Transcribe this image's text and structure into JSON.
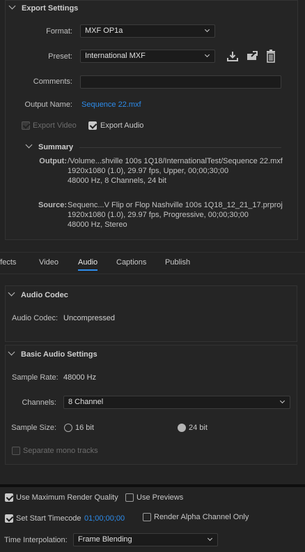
{
  "export_settings": {
    "title": "Export Settings",
    "format_label": "Format:",
    "format_value": "MXF OP1a",
    "preset_label": "Preset:",
    "preset_value": "International MXF",
    "comments_label": "Comments:",
    "comments_value": "",
    "output_name_label": "Output Name:",
    "output_name_value": "Sequence 22.mxf",
    "export_video_label": "Export Video",
    "export_video_checked": true,
    "export_audio_label": "Export Audio",
    "export_audio_checked": true
  },
  "summary": {
    "title": "Summary",
    "output_key": "Output:",
    "output_lines": [
      "/Volume...shville 100s 1Q18/InternationalTest/Sequence 22.mxf",
      "1920x1080 (1.0), 29.97 fps, Upper, 00;00;30;00",
      "48000 Hz, 8 Channels, 24 bit"
    ],
    "source_key": "Source:",
    "source_lines": [
      "Sequenc...V Flip or Flop Nashville 100s 1Q18_12_21_17.prproj",
      "1920x1080 (1.0), 29.97 fps, Progressive, 00;00;30;00",
      "48000 Hz, Stereo"
    ]
  },
  "tabs": [
    "Effects",
    "Video",
    "Audio",
    "Captions",
    "Publish"
  ],
  "active_tab": "Audio",
  "audio_codec": {
    "title": "Audio Codec",
    "codec_label": "Audio Codec:",
    "codec_value": "Uncompressed"
  },
  "basic_audio": {
    "title": "Basic Audio Settings",
    "sample_rate_label": "Sample Rate:",
    "sample_rate_value": "48000 Hz",
    "channels_label": "Channels:",
    "channels_value": "8 Channel",
    "sample_size_label": "Sample Size:",
    "option_16": "16 bit",
    "option_24": "24 bit",
    "selected_size": "24 bit",
    "separate_mono_label": "Separate mono tracks"
  },
  "bottom": {
    "max_render_label": "Use Maximum Render Quality",
    "use_previews_label": "Use Previews",
    "set_start_tc_label": "Set Start Timecode",
    "start_tc_value": "01;00;00;00",
    "render_alpha_label": "Render Alpha Channel Only",
    "time_interp_label": "Time Interpolation:",
    "time_interp_value": "Frame Blending"
  },
  "colors": {
    "accent": "#2d8ceb",
    "background": "#232323"
  }
}
